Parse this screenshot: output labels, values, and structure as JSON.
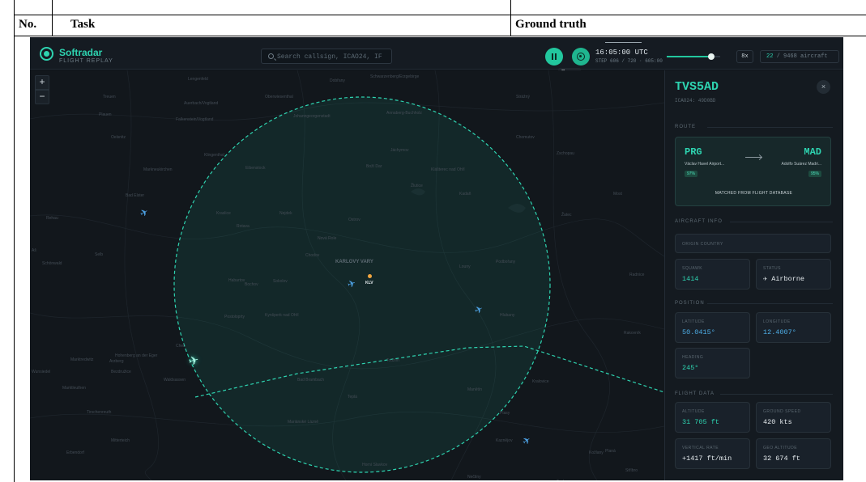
{
  "table": {
    "col_no": "No.",
    "col_task": "Task",
    "col_gt": "Ground truth"
  },
  "topbar": {
    "brand": "Softradar",
    "brand_sub": "FLIGHT REPLAY",
    "search_placeholder": "Search callsign, ICAO24, IF",
    "pause_tooltip": "Pause",
    "time": "16:05:00 UTC",
    "step": "STEP 606 / 720 · 605:00",
    "progress_fraction": 0.84,
    "speed": "8x",
    "count_shown": "22",
    "count_total": " / 9468 aircraft"
  },
  "map": {
    "zoom_in": "+",
    "zoom_out": "−",
    "airport_code": "KLV",
    "city": "KARLOVY VARY",
    "towns": [
      "Lengenfeld",
      "Treuen",
      "Auerbach/Vogtland",
      "Plauen",
      "Falkenstein/Vogtland",
      "Oelsnitz",
      "Klingenthal",
      "Markneukirchen",
      "Bad Elster",
      "Aš",
      "Selb",
      "Schönwald",
      "Rehau",
      "Cheb",
      "Marktredwitz",
      "Wunsiedel",
      "Arzberg",
      "Waldsassen",
      "Kraslice",
      "Rotava",
      "Nejdek",
      "Ostrov",
      "Nová Role",
      "Chodov",
      "Sokolov",
      "Habartov",
      "Mariánské Lázně",
      "Teplá",
      "Bochov",
      "Toužim",
      "Žlutice",
      "Jáchymov",
      "Boží Dar",
      "Oberwiesenthal",
      "Kadaň",
      "Chomutov",
      "Klášterec nad Ohří",
      "Podbořany",
      "Žatec",
      "Rakovník",
      "Kralovice",
      "Manětín",
      "Plasy",
      "Kaznějov",
      "Tachov",
      "Planá",
      "Stříbro",
      "Dobřany",
      "Eibenstock",
      "Johanngeorgenstadt",
      "Schwarzenberg/Erzgebirge",
      "Annaberg-Buchholz",
      "Zschopau",
      "Most",
      "Louny",
      "Postoloprty",
      "Kynšperk nad Ohří",
      "Horní Slavkov",
      "Bezdružice",
      "Marktleuthen",
      "Tirschenreuth",
      "Mitterteich",
      "Erbendorf",
      "Hohenberg an der Eger",
      "Bad Brambach",
      "Nečtiny",
      "Kožlany",
      "Radnice",
      "Hlubany",
      "Strážný"
    ]
  },
  "panel": {
    "callsign": "TVS5AD",
    "icao": "ICAO24: 49D0BD",
    "close": "×",
    "route_title": "ROUTE",
    "from_code": "PRG",
    "from_name": "Václav Havel Airport...",
    "from_pct": "97%",
    "to_code": "MAD",
    "to_name": "Adolfo Suárez Madri...",
    "to_pct": "95%",
    "route_source": "MATCHED FROM FLIGHT DATABASE",
    "aircraft_title": "AIRCRAFT INFO",
    "origin_country_label": "ORIGIN COUNTRY",
    "squawk_label": "SQUAWK",
    "squawk": "1414",
    "status_label": "STATUS",
    "status": "✈ Airborne",
    "position_title": "POSITION",
    "lat_label": "LATITUDE",
    "lat": "50.0415°",
    "lon_label": "LONGITUDE",
    "lon": "12.4007°",
    "heading_label": "HEADING",
    "heading": "245°",
    "flight_title": "FLIGHT DATA",
    "alt_label": "ALTITUDE",
    "alt": "31 705 ft",
    "gs_label": "GROUND SPEED",
    "gs": "420 kts",
    "vr_label": "VERTICAL RATE",
    "vr": "+1417 ft/min",
    "geo_label": "GEO ALTITUDE",
    "geo": "32 674 ft"
  },
  "colors": {
    "accent": "#2ed3b0",
    "plane": "#4ea3e6",
    "airport": "#f2a640"
  }
}
